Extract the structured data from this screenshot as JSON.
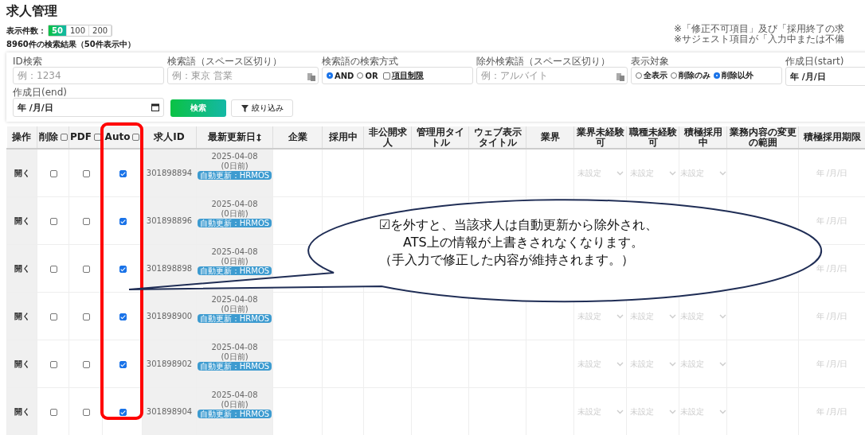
{
  "page": {
    "title": "求人管理"
  },
  "notes": [
    "※「修正不可項目」及び「採用終了の求",
    "※サジェスト項目が「入力中または不備"
  ],
  "page_size": {
    "label": "表示件数：",
    "options": [
      {
        "label": "50",
        "selected": true
      },
      {
        "label": "100",
        "selected": false
      },
      {
        "label": "200",
        "selected": false
      }
    ]
  },
  "result_summary": "8960件の検索結果（50件表示中）",
  "filters": [
    {
      "kind": "text",
      "label": "ID検索",
      "placeholder": "例：1234"
    },
    {
      "kind": "text_paste",
      "label": "検索語（スペース区切り）",
      "placeholder": "例：東京 営業"
    },
    {
      "kind": "radios",
      "label": "検索語の検索方式",
      "options": [
        {
          "label": "AND",
          "selected": true
        },
        {
          "label": "OR",
          "selected": false
        }
      ],
      "checkbox": {
        "label": "項目制限",
        "checked": false
      }
    },
    {
      "kind": "text_paste",
      "label": "除外検索語（スペース区切り）",
      "placeholder": "例：アルバイト"
    },
    {
      "kind": "radios",
      "label": "表示対象",
      "options": [
        {
          "label": "全表示",
          "selected": false
        },
        {
          "label": "削除のみ",
          "selected": false
        },
        {
          "label": "削除以外",
          "selected": true
        }
      ]
    },
    {
      "kind": "date",
      "label": "作成日(start)",
      "value": "年 /月/日"
    },
    {
      "kind": "date",
      "label": "作成日(end)",
      "value": "年 /月/日"
    }
  ],
  "search_button": "検索",
  "filter_button": "絞り込み",
  "columns": [
    {
      "label": "操作",
      "kind": "plain"
    },
    {
      "label": "削除",
      "kind": "checkbox",
      "checked": false
    },
    {
      "label": "PDF",
      "kind": "checkbox",
      "checked": false
    },
    {
      "label": "Auto",
      "kind": "checkbox",
      "checked": false
    },
    {
      "label": "求人ID",
      "kind": "plain"
    },
    {
      "label": "最新更新日",
      "kind": "sortable"
    },
    {
      "label": "企業",
      "kind": "plain"
    },
    {
      "label": "採用中",
      "kind": "plain"
    },
    {
      "label": "非公開求人",
      "kind": "plain"
    },
    {
      "label": "管理用タイトル",
      "kind": "plain"
    },
    {
      "label": "ウェブ表示タイトル",
      "kind": "plain"
    },
    {
      "label": "業界",
      "kind": "plain"
    },
    {
      "label": "業界未経験可",
      "kind": "plain"
    },
    {
      "label": "職種未経験可",
      "kind": "plain"
    },
    {
      "label": "積極採用中",
      "kind": "plain"
    },
    {
      "label": "業務内容の変更の範囲",
      "kind": "plain"
    },
    {
      "label": "積極採用期限",
      "kind": "plain"
    }
  ],
  "rows": [
    {
      "action": "開く",
      "delete": false,
      "pdf": false,
      "auto": true,
      "id": "301898894",
      "date": "2025-04-08",
      "ago": "(0日前)",
      "badge": "自動更新：HRMOS",
      "selects": [
        "未設定",
        "未設定",
        "未設定"
      ],
      "deadline": "年 /月/日"
    },
    {
      "action": "開く",
      "delete": false,
      "pdf": false,
      "auto": true,
      "id": "301898896",
      "date": "2025-04-08",
      "ago": "(0日前)",
      "badge": "自動更新：HRMOS",
      "deadline": "年 /月/日"
    },
    {
      "action": "開く",
      "delete": false,
      "pdf": false,
      "auto": true,
      "id": "301898898",
      "date": "2025-04-08",
      "ago": "(0日前)",
      "badge": "自動更新：HRMOS",
      "deadline": "年 /月/日"
    },
    {
      "action": "開く",
      "delete": false,
      "pdf": false,
      "auto": true,
      "id": "301898900",
      "date": "2025-04-08",
      "ago": "(0日前)",
      "badge": "自動更新：HRMOS",
      "selects": [
        "未設定",
        "未設定",
        "未設定"
      ],
      "deadline": "年 /月/日"
    },
    {
      "action": "開く",
      "delete": false,
      "pdf": false,
      "auto": true,
      "id": "301898902",
      "date": "2025-04-08",
      "ago": "(0日前)",
      "badge": "自動更新：HRMOS",
      "selects": [
        "未設定",
        "未設定",
        "未設定"
      ],
      "deadline": "年 /月/日"
    },
    {
      "action": "開く",
      "delete": false,
      "pdf": false,
      "auto": true,
      "id": "301898904",
      "date": "2025-04-08",
      "ago": "(0日前)",
      "badge": "自動更新：HRMOS",
      "selects": [
        "未設定",
        "未設定",
        "未設定"
      ],
      "deadline": "年 /月/日"
    }
  ],
  "callout": {
    "lines": [
      "☑を外すと、当該求人は自動更新から除外され、",
      "ATS上の情報が上書きされなくなります。",
      "（手入力で修正した内容が維持されます。）"
    ]
  }
}
